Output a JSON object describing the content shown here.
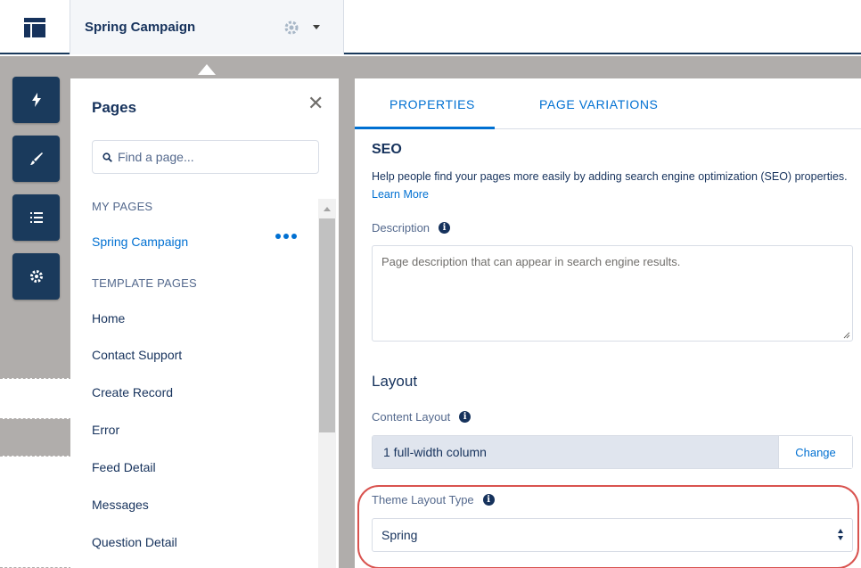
{
  "topbar": {
    "page_name": "Spring Campaign"
  },
  "dock": {
    "items": [
      "lightning-icon",
      "brush-icon",
      "list-icon",
      "gear-icon"
    ]
  },
  "pages_panel": {
    "title": "Pages",
    "search_placeholder": "Find a page...",
    "my_pages_heading": "MY PAGES",
    "my_pages": [
      "Spring Campaign"
    ],
    "template_pages_heading": "TEMPLATE PAGES",
    "template_pages": [
      "Home",
      "Contact Support",
      "Create Record",
      "Error",
      "Feed Detail",
      "Messages",
      "Question Detail"
    ]
  },
  "properties": {
    "tabs": [
      "PROPERTIES",
      "PAGE VARIATIONS"
    ],
    "active_tab": "PROPERTIES",
    "seo": {
      "title": "SEO",
      "help_text": "Help people find your pages more easily by adding search engine optimization (SEO) properties.",
      "learn_more": "Learn More",
      "description_label": "Description",
      "description_placeholder": "Page description that can appear in search engine results."
    },
    "layout": {
      "title": "Layout",
      "content_layout_label": "Content Layout",
      "content_layout_value": "1 full-width column",
      "change_label": "Change",
      "theme_layout_type_label": "Theme Layout Type",
      "theme_layout_type_value": "Spring"
    }
  },
  "colors": {
    "brand_navy": "#1a3a5c",
    "link_blue": "#0070d2",
    "highlight_red": "#d9534f"
  }
}
